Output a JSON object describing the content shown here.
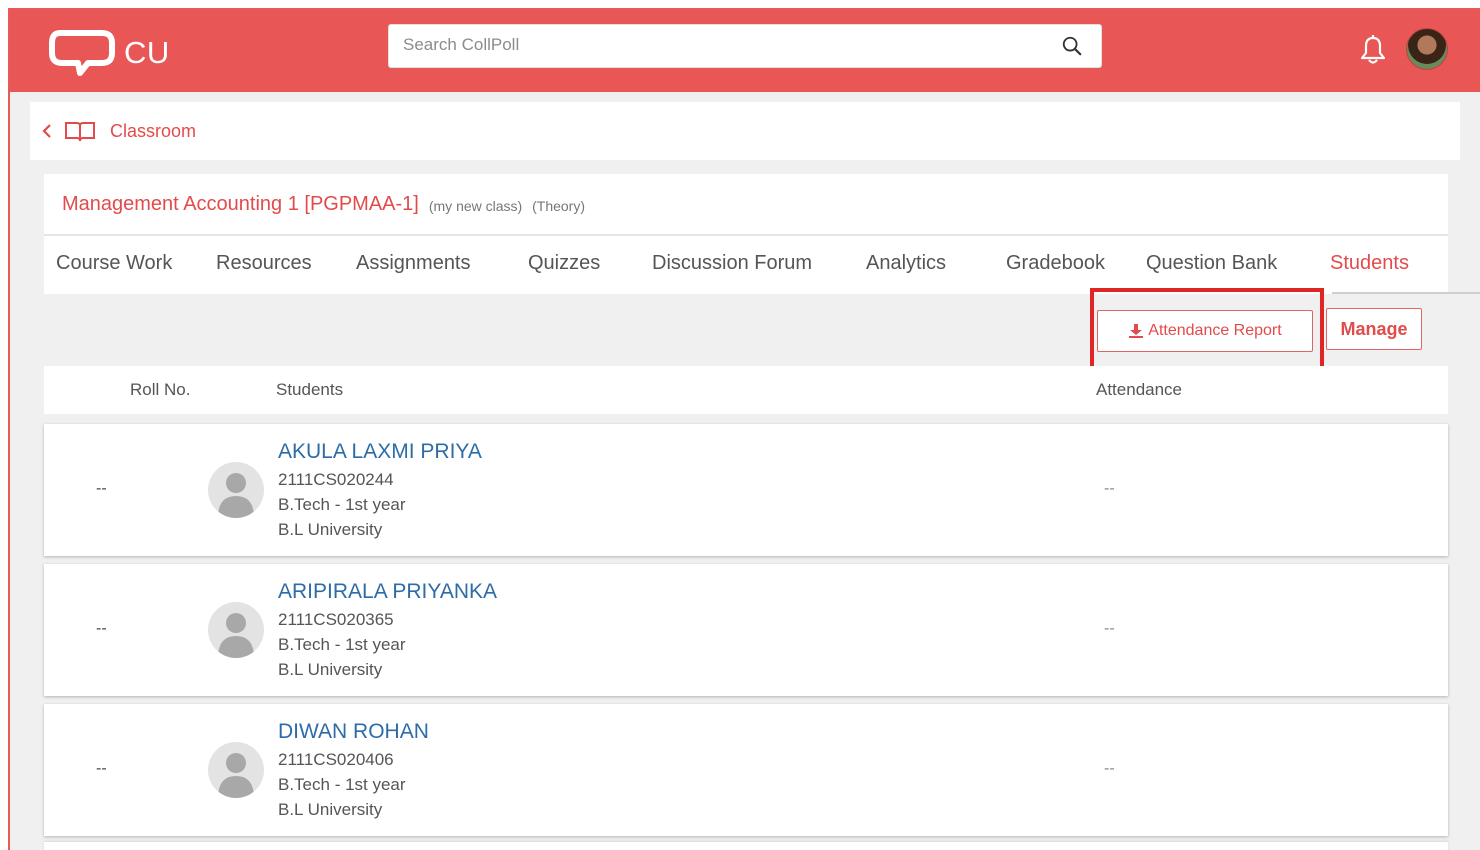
{
  "header": {
    "logo_text": "CU",
    "search_placeholder": "Search CollPoll"
  },
  "breadcrumb": {
    "label": "Classroom"
  },
  "class_info": {
    "title": "Management Accounting 1 [PGPMAA-1]",
    "tag1": "(my new class)",
    "tag2": "(Theory)"
  },
  "tabs": [
    {
      "label": "Course Work"
    },
    {
      "label": "Resources"
    },
    {
      "label": "Assignments"
    },
    {
      "label": "Quizzes"
    },
    {
      "label": "Discussion Forum"
    },
    {
      "label": "Analytics"
    },
    {
      "label": "Gradebook"
    },
    {
      "label": "Question Bank"
    },
    {
      "label": "Students",
      "active": true
    }
  ],
  "actions": {
    "attendance_report": "Attendance Report",
    "manage": "Manage"
  },
  "table": {
    "headers": {
      "roll": "Roll No.",
      "students": "Students",
      "attendance": "Attendance"
    },
    "rows": [
      {
        "roll": "--",
        "name": "AKULA LAXMI PRIYA",
        "id": "2111CS020244",
        "program": "B.Tech - 1st year",
        "university": "B.L University",
        "attendance": "--"
      },
      {
        "roll": "--",
        "name": "ARIPIRALA PRIYANKA",
        "id": "2111CS020365",
        "program": "B.Tech - 1st year",
        "university": "B.L University",
        "attendance": "--"
      },
      {
        "roll": "--",
        "name": "DIWAN ROHAN",
        "id": "2111CS020406",
        "program": "B.Tech - 1st year",
        "university": "B.L University",
        "attendance": "--"
      }
    ]
  },
  "colors": {
    "brand": "#e85656",
    "accent_text": "#e34b4b",
    "link": "#2e6ca8",
    "highlight": "#e02525"
  },
  "icons": [
    "logo-chat-icon",
    "search-icon",
    "bell-icon",
    "back-chevron-icon",
    "book-icon",
    "download-icon",
    "avatar-placeholder-icon"
  ]
}
